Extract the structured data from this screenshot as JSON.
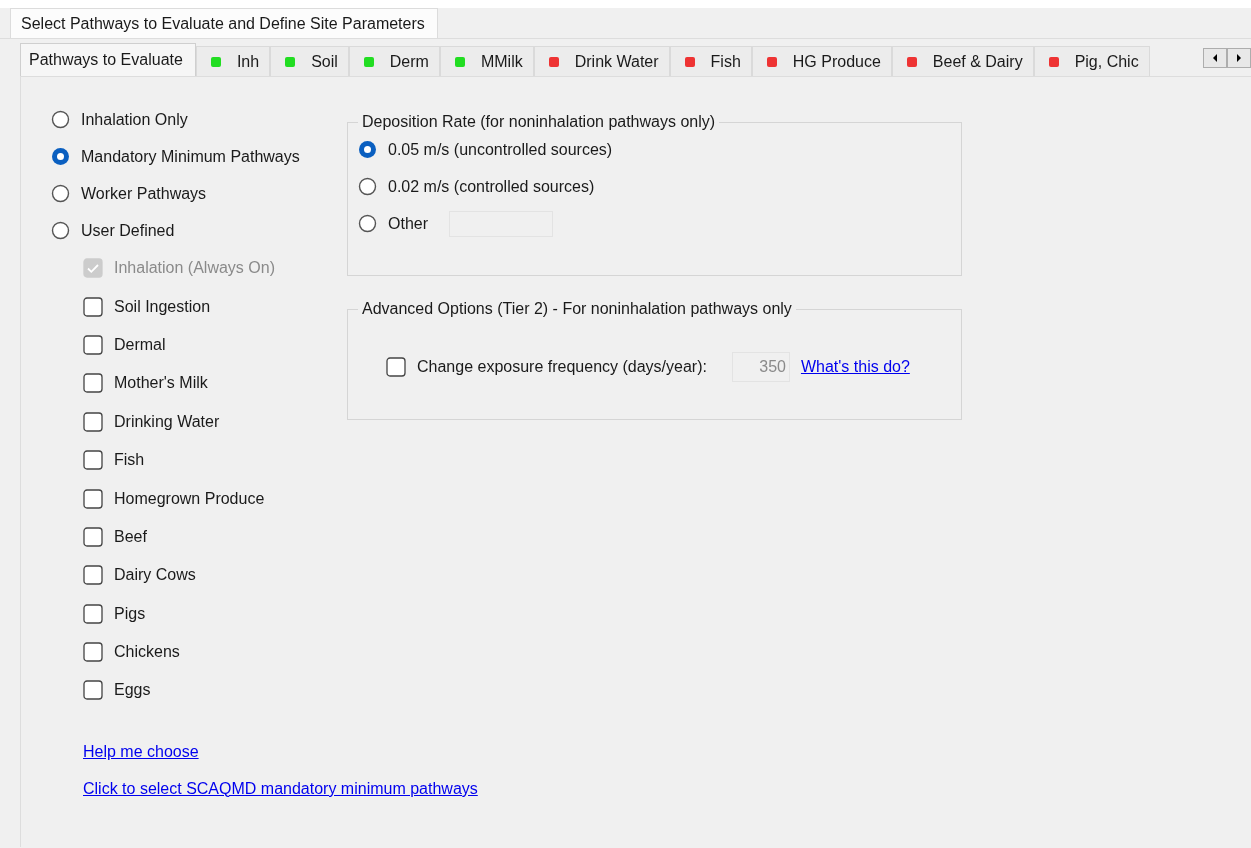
{
  "window": {
    "title": "Select Pathways to Evaluate and Define Site Parameters"
  },
  "tabs": [
    {
      "label": "Pathways to Evaluate",
      "selected": true
    },
    {
      "label": "Inh",
      "selected": false,
      "color": "#22dd22"
    },
    {
      "label": "Soil",
      "selected": false,
      "color": "#22dd22"
    },
    {
      "label": "Derm",
      "selected": false,
      "color": "#22dd22"
    },
    {
      "label": "MMilk",
      "selected": false,
      "color": "#22dd22"
    },
    {
      "label": "Drink Water",
      "selected": false,
      "color": "#ee3333"
    },
    {
      "label": "Fish",
      "selected": false,
      "color": "#ee3333"
    },
    {
      "label": "HG Produce",
      "selected": false,
      "color": "#ee3333"
    },
    {
      "label": "Beef & Dairy",
      "selected": false,
      "color": "#ee3333"
    },
    {
      "label": "Pig, Chic",
      "selected": false,
      "color": "#ee3333"
    }
  ],
  "pathway_options": [
    {
      "label": "Inhalation Only",
      "selected": false
    },
    {
      "label": "Mandatory Minimum Pathways",
      "selected": true
    },
    {
      "label": "Worker Pathways",
      "selected": false
    },
    {
      "label": "User Defined",
      "selected": false
    }
  ],
  "pathways": [
    {
      "label": "Inhalation (Always On)",
      "checked": true,
      "disabled": true
    },
    {
      "label": "Soil Ingestion",
      "checked": false,
      "disabled": false
    },
    {
      "label": "Dermal",
      "checked": false,
      "disabled": false
    },
    {
      "label": "Mother's Milk",
      "checked": false,
      "disabled": false
    },
    {
      "label": "Drinking Water",
      "checked": false,
      "disabled": false
    },
    {
      "label": "Fish",
      "checked": false,
      "disabled": false
    },
    {
      "label": "Homegrown Produce",
      "checked": false,
      "disabled": false
    },
    {
      "label": "Beef",
      "checked": false,
      "disabled": false
    },
    {
      "label": "Dairy Cows",
      "checked": false,
      "disabled": false
    },
    {
      "label": "Pigs",
      "checked": false,
      "disabled": false
    },
    {
      "label": "Chickens",
      "checked": false,
      "disabled": false
    },
    {
      "label": "Eggs",
      "checked": false,
      "disabled": false
    }
  ],
  "links": [
    "Help me choose",
    "Click to select SCAQMD mandatory minimum pathways"
  ],
  "deposition_rate": {
    "title": "Deposition Rate (for noninhalation pathways only)",
    "options": [
      {
        "label": "0.05 m/s (uncontrolled sources)",
        "selected": true,
        "kind": "radio"
      },
      {
        "label": "0.02 m/s (controlled sources)",
        "selected": false,
        "kind": "radio"
      },
      {
        "label": "Other",
        "selected": false,
        "kind": "radio-field"
      }
    ]
  },
  "advanced_options": {
    "title": "Advanced Options (Tier 2) - For noninhalation pathways only",
    "exposure_frequency": {
      "label": "Change exposure frequency (days/year):",
      "checked": false,
      "value": "350",
      "disabled": true
    },
    "help_link": "What's this do?"
  }
}
